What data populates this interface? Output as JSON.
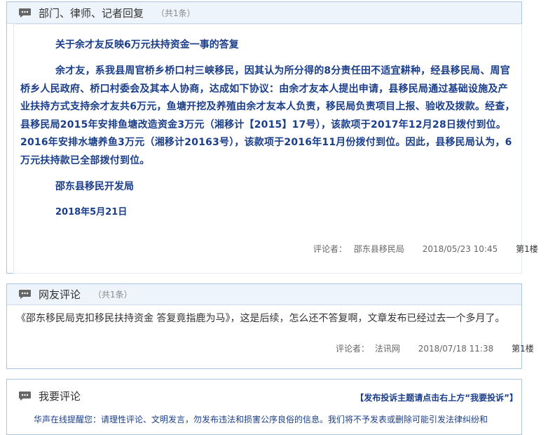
{
  "reply_panel": {
    "title": "部门、律师、记者回复",
    "count": "（共1条）",
    "reply_title": "关于余才友反映6万元扶持资金一事的答复",
    "reply_text": "余才友，系我县周官桥乡桥口村三峡移民，因其认为所分得的8分责任田不适宜耕种，经县移民局、周官桥乡人民政府、桥口村委会及其本人协商，达成如下协议：由余才友本人提出申请，县移民局通过基础设施及产业扶持方式支持余才友共6万元，鱼塘开挖及养殖由余才友本人负责，移民局负责项目上报、验收及拨款。经查，县移民局2015年安排鱼塘改造资金3万元（湘移计【2015】17号），该款项于2017年12月28日拨付到位。2016年安排水塘养鱼3万元（湘移计20163号），该款项于2016年11月份拨付到位。因此，县移民局认为，6万元扶持款已全部拨付到位。",
    "signature": "邵东县移民开发局",
    "date": "2018年5月21日",
    "meta": {
      "commenter_label": "评论者：",
      "commenter": "邵东县移民局",
      "time": "2018/05/23 10:45",
      "floor": "第1楼"
    }
  },
  "netizen_panel": {
    "title": "网友评论",
    "count": "（共1条）",
    "comment_text": "《邵东移民局克扣移民扶持资金 答复竟指鹿为马》，这是后续，怎么还不答复啊，文章发布已经过去一个多月了。",
    "meta": {
      "commenter_label": "评论者：",
      "commenter": "法讯网",
      "time": "2018/07/18 11:38",
      "floor": "第1楼"
    }
  },
  "comment_panel": {
    "title": "我要评论",
    "post_link": "【发布投诉主题请点击右上方“我要投诉”】",
    "notice": "华声在线提醒您：请理性评论、文明发言，勿发布违法和损害公序良俗的信息。我们将不予发表或删除可能引发法律纠纷和"
  },
  "colors": {
    "header_bg": "#eef4fb",
    "border": "#a9c4e2",
    "reply_text": "#1a3e8a"
  },
  "icons": [
    "chat-bubble-icon"
  ]
}
